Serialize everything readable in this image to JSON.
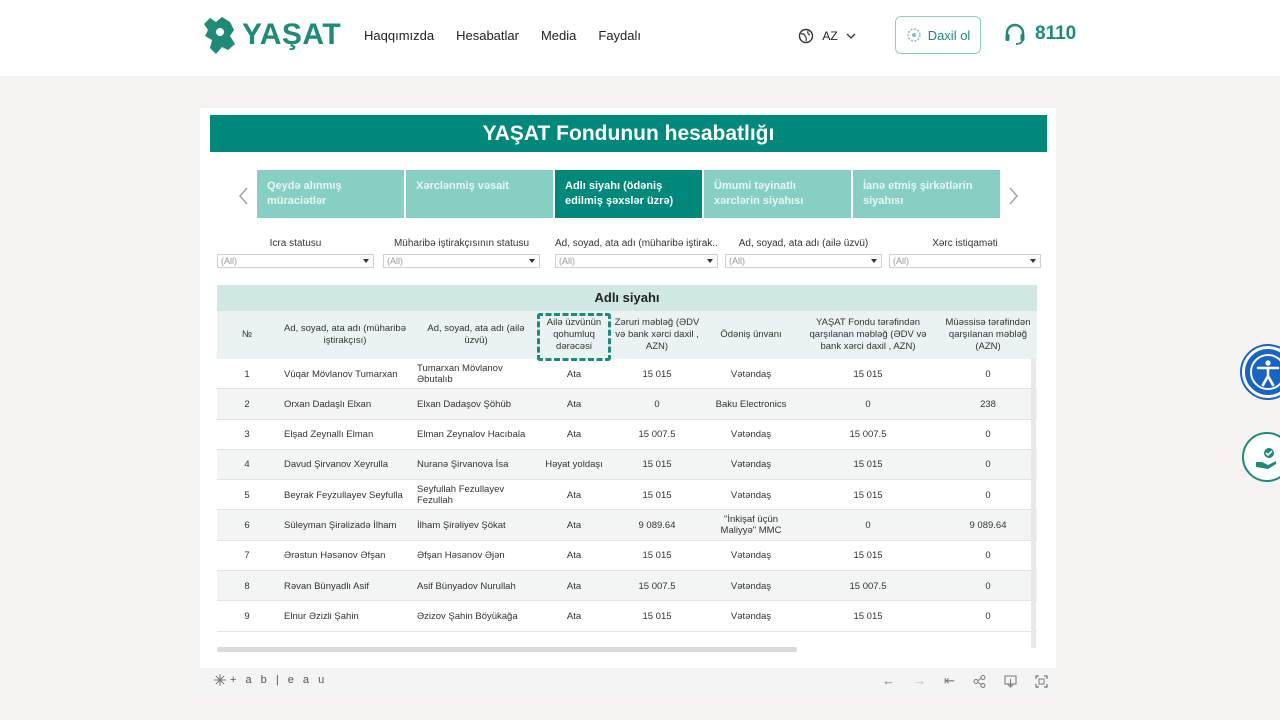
{
  "header": {
    "logo_text": "YAŞAT",
    "nav": [
      "Haqqımızda",
      "Hesabatlar",
      "Media",
      "Faydalı"
    ],
    "language": "AZ",
    "login_label": "Daxil ol",
    "hotline": "8110"
  },
  "report": {
    "title": "YAŞAT Fondunun hesabatlığı",
    "tabs": [
      "Qeydə alınmış müraciətlər",
      "Xərclənmiş vəsait",
      "Adlı siyahı (ödəniş edilmiş şəxslər üzrə)",
      "Ümumi təyinatlı xərclərin siyahısı",
      "İanə etmiş şirkətlərin siyahısı"
    ],
    "active_tab": 2,
    "filters": [
      {
        "label": "İcra statusu",
        "value": "(All)"
      },
      {
        "label": "Müharibə iştirakçısının statusu",
        "value": "(All)"
      },
      {
        "label": "Ad, soyad, ata adı (müharibə iştirak...",
        "value": "(All)"
      },
      {
        "label": "Ad, soyad, ata adı (ailə üzvü)",
        "value": "(All)"
      },
      {
        "label": "Xərc istiqaməti",
        "value": "(All)"
      }
    ],
    "table": {
      "title": "Adlı siyahı",
      "columns": [
        "№",
        "Ad, soyad, ata adı (müharibə iştirakçısı)",
        "Ad, soyad, ata adı (ailə üzvü)",
        "Ailə üzvünün qohumluq dərəcəsi",
        "Zəruri məbləğ (ƏDV və bank xərci daxil , AZN)",
        "Ödəniş ünvanı",
        "YAŞAT Fondu tərəfindən qarşılanan məbləğ (ƏDV və bank xərci daxil , AZN)",
        "Müəssisə tərəfindən qarşılanan məbləğ (AZN)"
      ],
      "rows": [
        [
          "1",
          "Vüqar Mövlanov Tumarxan",
          "Tumarxan Mövlanov Əbutalıb",
          "Ata",
          "15 015",
          "Vətəndaş",
          "15 015",
          "0"
        ],
        [
          "2",
          "Orxan Dadaşlı Elxan",
          "Elxan Dadaşov Şöhüb",
          "Ata",
          "0",
          "Baku Electronics",
          "0",
          "238"
        ],
        [
          "3",
          "Elşad Zeynallı Elman",
          "Elman Zeynalov Hacıbala",
          "Ata",
          "15 007.5",
          "Vətəndaş",
          "15 007.5",
          "0"
        ],
        [
          "4",
          "Davud Şirvanov Xeyrulla",
          "Nuranə Şirvanova İsa",
          "Həyat yoldaşı",
          "15 015",
          "Vətəndaş",
          "15 015",
          "0"
        ],
        [
          "5",
          "Beyrak Feyzullayev Seyfulla",
          "Seyfullah Fezullayev Fezullah",
          "Ata",
          "15 015",
          "Vətəndaş",
          "15 015",
          "0"
        ],
        [
          "6",
          "Süleyman Şirəlizadə İlham",
          "İlham Şirəliyev Şökat",
          "Ata",
          "9 089.64",
          "\"İnkişaf üçün Maliyyə\" MMC",
          "0",
          "9 089.64"
        ],
        [
          "7",
          "Ərəstun Həsənov Əfşan",
          "Əfşan Həsənov Əjən",
          "Ata",
          "15 015",
          "Vətəndaş",
          "15 015",
          "0"
        ],
        [
          "8",
          "Rəvan Bünyadlı Asif",
          "Asif Bünyadov Nurullah",
          "Ata",
          "15 007.5",
          "Vətəndaş",
          "15 007.5",
          "0"
        ],
        [
          "9",
          "Elnur Əzizli Şahin",
          "Əzizov Şahin Böyükağa",
          "Ata",
          "15 015",
          "Vətəndaş",
          "15 015",
          "0"
        ]
      ]
    },
    "footer_brand": "+ a b | e a u"
  }
}
